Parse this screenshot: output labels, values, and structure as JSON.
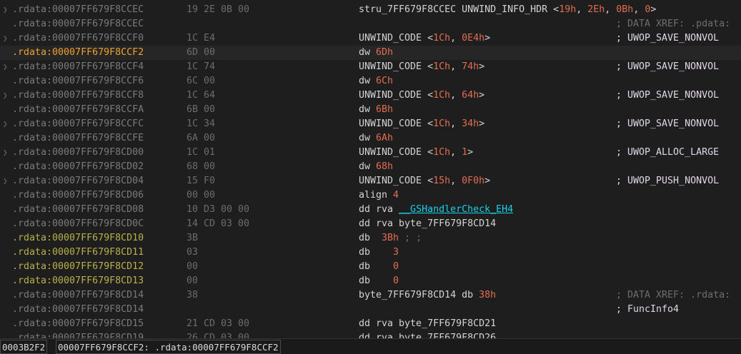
{
  "colors": {
    "background": "#1e1e1e",
    "address_gray": "#7a7a7a",
    "address_olive": "#b8b04a",
    "address_current": "#f0a030",
    "number": "#e26d51",
    "function_ref": "#18d0e8"
  },
  "rows": [
    {
      "addr": ".rdata:00007FF679F8CCEC",
      "addr_color": "#7a7a7a",
      "arrow": true,
      "bytes": "19 2E 0B 00",
      "instr": [
        {
          "t": "stru_7FF679F8CCEC UNWIND_INFO_HDR <"
        },
        {
          "t": "19h",
          "c": "num"
        },
        {
          "t": ", "
        },
        {
          "t": "2Eh",
          "c": "num"
        },
        {
          "t": ", "
        },
        {
          "t": "0Bh",
          "c": "num"
        },
        {
          "t": ", "
        },
        {
          "t": "0",
          "c": "num"
        },
        {
          "t": ">"
        }
      ],
      "comment": "",
      "comment_color": "gray"
    },
    {
      "addr": ".rdata:00007FF679F8CCEC",
      "addr_color": "#7a7a7a",
      "arrow": false,
      "bytes": "",
      "instr": [],
      "comment": "; DATA XREF: .pdata:",
      "comment_color": "gray"
    },
    {
      "addr": ".rdata:00007FF679F8CCF0",
      "addr_color": "#7a7a7a",
      "arrow": true,
      "bytes": "1C E4",
      "instr": [
        {
          "t": "UNWIND_CODE <"
        },
        {
          "t": "1Ch",
          "c": "num"
        },
        {
          "t": ", "
        },
        {
          "t": "0E4h",
          "c": "num"
        },
        {
          "t": ">"
        }
      ],
      "comment": "; UWOP_SAVE_NONVOL",
      "comment_color": "white"
    },
    {
      "addr": ".rdata:00007FF679F8CCF2",
      "addr_color": "#f0a030",
      "arrow": false,
      "bytes": "6D 00",
      "instr": [
        {
          "t": "dw "
        },
        {
          "t": "6Dh",
          "c": "num"
        }
      ],
      "comment": "",
      "comment_color": "gray",
      "current": true
    },
    {
      "addr": ".rdata:00007FF679F8CCF4",
      "addr_color": "#7a7a7a",
      "arrow": true,
      "bytes": "1C 74",
      "instr": [
        {
          "t": "UNWIND_CODE <"
        },
        {
          "t": "1Ch",
          "c": "num"
        },
        {
          "t": ", "
        },
        {
          "t": "74h",
          "c": "num"
        },
        {
          "t": ">"
        }
      ],
      "comment": "; UWOP_SAVE_NONVOL",
      "comment_color": "white"
    },
    {
      "addr": ".rdata:00007FF679F8CCF6",
      "addr_color": "#7a7a7a",
      "arrow": false,
      "bytes": "6C 00",
      "instr": [
        {
          "t": "dw "
        },
        {
          "t": "6Ch",
          "c": "num"
        }
      ],
      "comment": "",
      "comment_color": "gray"
    },
    {
      "addr": ".rdata:00007FF679F8CCF8",
      "addr_color": "#7a7a7a",
      "arrow": true,
      "bytes": "1C 64",
      "instr": [
        {
          "t": "UNWIND_CODE <"
        },
        {
          "t": "1Ch",
          "c": "num"
        },
        {
          "t": ", "
        },
        {
          "t": "64h",
          "c": "num"
        },
        {
          "t": ">"
        }
      ],
      "comment": "; UWOP_SAVE_NONVOL",
      "comment_color": "white"
    },
    {
      "addr": ".rdata:00007FF679F8CCFA",
      "addr_color": "#7a7a7a",
      "arrow": false,
      "bytes": "6B 00",
      "instr": [
        {
          "t": "dw "
        },
        {
          "t": "6Bh",
          "c": "num"
        }
      ],
      "comment": "",
      "comment_color": "gray"
    },
    {
      "addr": ".rdata:00007FF679F8CCFC",
      "addr_color": "#7a7a7a",
      "arrow": true,
      "bytes": "1C 34",
      "instr": [
        {
          "t": "UNWIND_CODE <"
        },
        {
          "t": "1Ch",
          "c": "num"
        },
        {
          "t": ", "
        },
        {
          "t": "34h",
          "c": "num"
        },
        {
          "t": ">"
        }
      ],
      "comment": "; UWOP_SAVE_NONVOL",
      "comment_color": "white"
    },
    {
      "addr": ".rdata:00007FF679F8CCFE",
      "addr_color": "#7a7a7a",
      "arrow": false,
      "bytes": "6A 00",
      "instr": [
        {
          "t": "dw "
        },
        {
          "t": "6Ah",
          "c": "num"
        }
      ],
      "comment": "",
      "comment_color": "gray"
    },
    {
      "addr": ".rdata:00007FF679F8CD00",
      "addr_color": "#7a7a7a",
      "arrow": true,
      "bytes": "1C 01",
      "instr": [
        {
          "t": "UNWIND_CODE <"
        },
        {
          "t": "1Ch",
          "c": "num"
        },
        {
          "t": ", "
        },
        {
          "t": "1",
          "c": "num"
        },
        {
          "t": ">"
        }
      ],
      "comment": "; UWOP_ALLOC_LARGE",
      "comment_color": "white"
    },
    {
      "addr": ".rdata:00007FF679F8CD02",
      "addr_color": "#7a7a7a",
      "arrow": false,
      "bytes": "68 00",
      "instr": [
        {
          "t": "dw "
        },
        {
          "t": "68h",
          "c": "num"
        }
      ],
      "comment": "",
      "comment_color": "gray"
    },
    {
      "addr": ".rdata:00007FF679F8CD04",
      "addr_color": "#7a7a7a",
      "arrow": true,
      "bytes": "15 F0",
      "instr": [
        {
          "t": "UNWIND_CODE <"
        },
        {
          "t": "15h",
          "c": "num"
        },
        {
          "t": ", "
        },
        {
          "t": "0F0h",
          "c": "num"
        },
        {
          "t": ">"
        }
      ],
      "comment": "; UWOP_PUSH_NONVOL",
      "comment_color": "white"
    },
    {
      "addr": ".rdata:00007FF679F8CD06",
      "addr_color": "#7a7a7a",
      "arrow": false,
      "bytes": "00 00",
      "instr": [
        {
          "t": "align "
        },
        {
          "t": "4",
          "c": "num"
        }
      ],
      "comment": "",
      "comment_color": "gray"
    },
    {
      "addr": ".rdata:00007FF679F8CD08",
      "addr_color": "#7a7a7a",
      "arrow": false,
      "bytes": "10 D3 00 00",
      "instr": [
        {
          "t": "dd rva "
        },
        {
          "t": "__GSHandlerCheck_EH4",
          "c": "func"
        }
      ],
      "comment": "",
      "comment_color": "gray"
    },
    {
      "addr": ".rdata:00007FF679F8CD0C",
      "addr_color": "#7a7a7a",
      "arrow": false,
      "bytes": "14 CD 03 00",
      "instr": [
        {
          "t": "dd rva byte_7FF679F8CD14"
        }
      ],
      "comment": "",
      "comment_color": "gray"
    },
    {
      "addr": ".rdata:00007FF679F8CD10",
      "addr_color": "#b8b04a",
      "arrow": false,
      "bytes": "3B",
      "instr": [
        {
          "t": "db  "
        },
        {
          "t": "3Bh",
          "c": "num"
        },
        {
          "t": " ; ;",
          "c": "gray"
        }
      ],
      "comment": "",
      "comment_color": "gray"
    },
    {
      "addr": ".rdata:00007FF679F8CD11",
      "addr_color": "#b8b04a",
      "arrow": false,
      "bytes": "03",
      "instr": [
        {
          "t": "db    "
        },
        {
          "t": "3",
          "c": "num"
        }
      ],
      "comment": "",
      "comment_color": "gray"
    },
    {
      "addr": ".rdata:00007FF679F8CD12",
      "addr_color": "#b8b04a",
      "arrow": false,
      "bytes": "00",
      "instr": [
        {
          "t": "db    "
        },
        {
          "t": "0",
          "c": "num"
        }
      ],
      "comment": "",
      "comment_color": "gray"
    },
    {
      "addr": ".rdata:00007FF679F8CD13",
      "addr_color": "#b8b04a",
      "arrow": false,
      "bytes": "00",
      "instr": [
        {
          "t": "db    "
        },
        {
          "t": "0",
          "c": "num"
        }
      ],
      "comment": "",
      "comment_color": "gray"
    },
    {
      "addr": ".rdata:00007FF679F8CD14",
      "addr_color": "#7a7a7a",
      "arrow": false,
      "bytes": "38",
      "instr": [
        {
          "t": "byte_7FF679F8CD14 db "
        },
        {
          "t": "38h",
          "c": "num"
        }
      ],
      "comment": "; DATA XREF: .rdata:",
      "comment_color": "gray"
    },
    {
      "addr": ".rdata:00007FF679F8CD14",
      "addr_color": "#7a7a7a",
      "arrow": false,
      "bytes": "",
      "instr": [],
      "comment": "; FuncInfo4",
      "comment_color": "white"
    },
    {
      "addr": ".rdata:00007FF679F8CD15",
      "addr_color": "#7a7a7a",
      "arrow": false,
      "bytes": "21 CD 03 00",
      "instr": [
        {
          "t": "dd rva byte_7FF679F8CD21"
        }
      ],
      "comment": "",
      "comment_color": "gray"
    },
    {
      "addr": ".rdata:00007FF679F8CD19",
      "addr_color": "#7a7a7a",
      "arrow": false,
      "bytes": "26 CD 03 00",
      "instr": [
        {
          "t": "dd rva byte_7FF679F8CD26"
        }
      ],
      "comment": "",
      "comment_color": "gray"
    }
  ],
  "status": {
    "file_offset": "0003B2F2",
    "location": "00007FF679F8CCF2: .rdata:00007FF679F8CCF2"
  }
}
